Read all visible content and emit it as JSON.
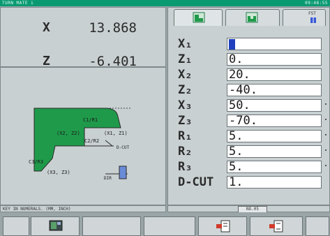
{
  "header": {
    "app_title": "TURN MATE i",
    "clock": "09:48:55"
  },
  "position": {
    "x_label": "X",
    "x_value": "13.868",
    "z_label": "Z",
    "z_value": "-6.401"
  },
  "diagram": {
    "labels": {
      "c1": "C1/R1",
      "p1": "(X1, Z1)",
      "p2": "(X2, Z2)",
      "c2": "C2/R2",
      "dcut": "D-CUT",
      "c3": "C3/R3",
      "p3": "(X3, Z3)",
      "dir": "DIR"
    }
  },
  "tabs": {
    "fst": "FST",
    "items": [
      {
        "icon": "taper-profile-icon"
      },
      {
        "icon": "groove-profile-icon"
      },
      {
        "icon": "fst-icon"
      }
    ]
  },
  "params": [
    {
      "label": "X₁",
      "value": ""
    },
    {
      "label": "Z₁",
      "value": "0."
    },
    {
      "label": "X₂",
      "value": "20."
    },
    {
      "label": "Z₂",
      "value": "-40."
    },
    {
      "label": "X₃",
      "value": "50."
    },
    {
      "label": "Z₃",
      "value": "-70."
    },
    {
      "label": "R₁",
      "value": "5."
    },
    {
      "label": "R₂",
      "value": "5."
    },
    {
      "label": "R₃",
      "value": "5."
    },
    {
      "label": "D-CUT",
      "value": "1."
    }
  ],
  "status": {
    "message": "KEY IN NUMERALS. (MM, INCH)",
    "mode": "NO.05"
  },
  "colors": {
    "title_bar": "#0a9a72",
    "profile_fill": "#1f9a4a",
    "cursor": "#1f3fbf",
    "panel": "#c9d0d2"
  }
}
